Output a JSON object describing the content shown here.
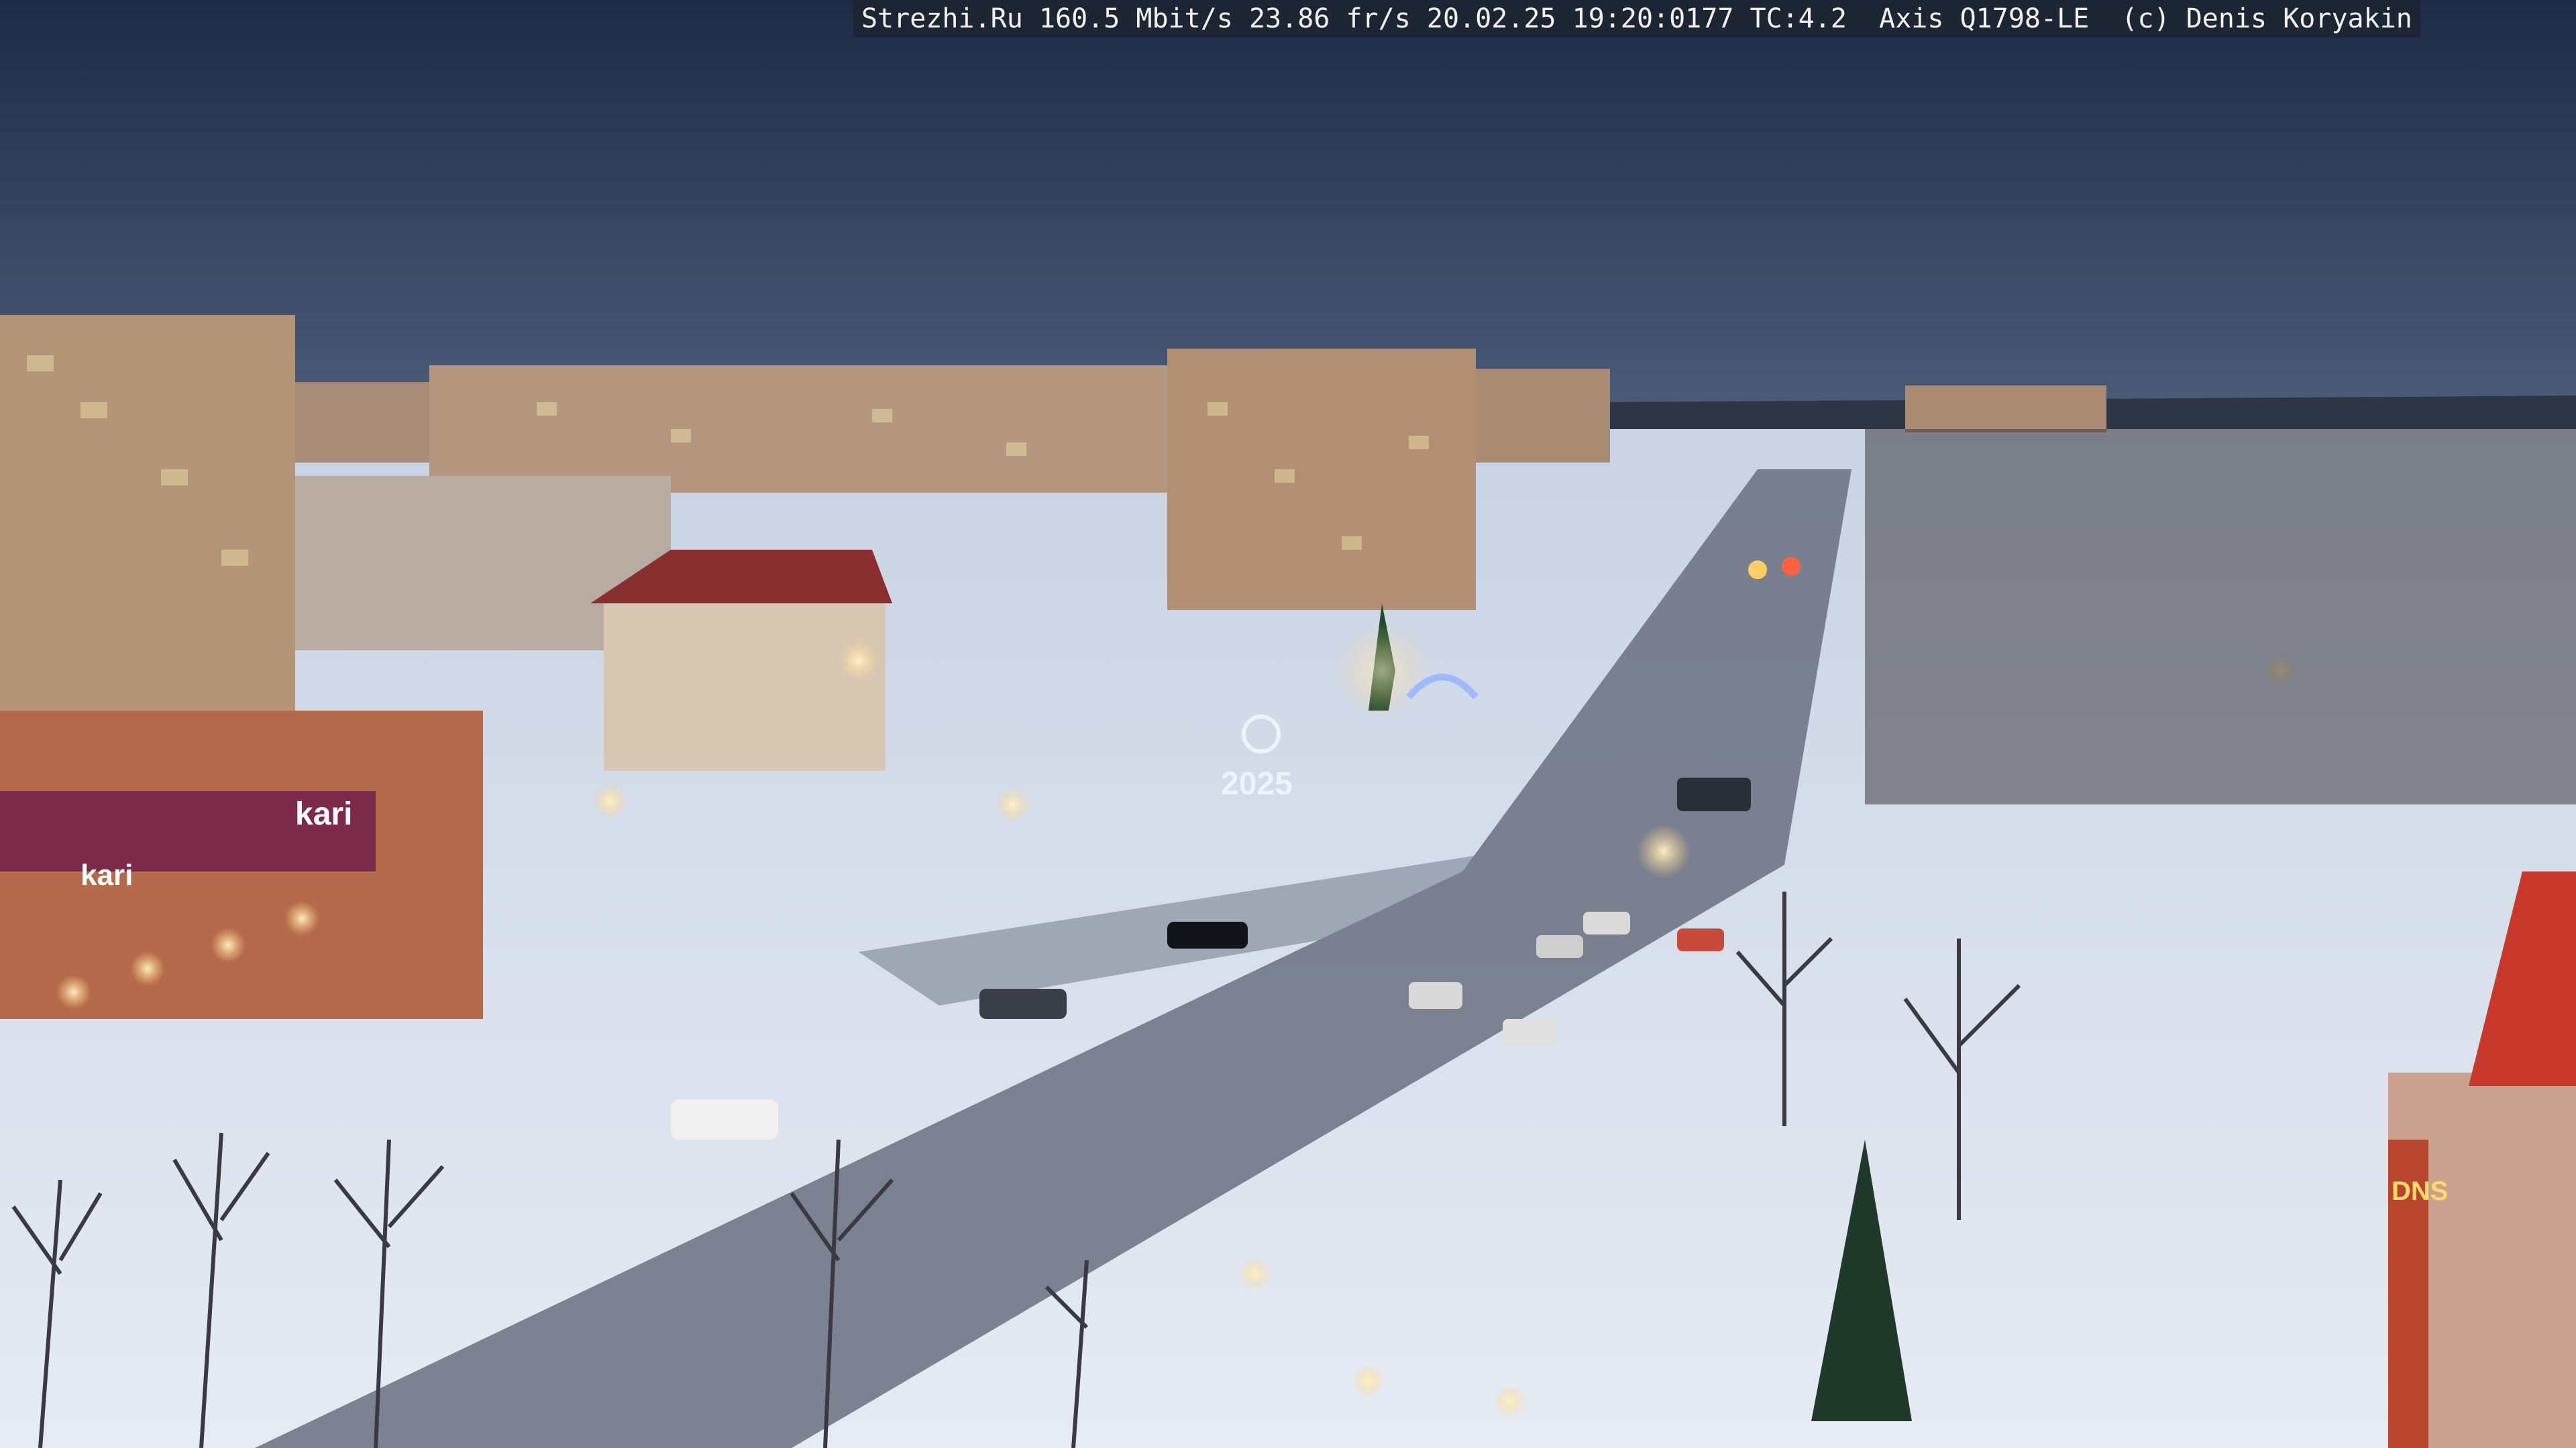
{
  "overlay": {
    "text": "Strezhi.Ru 160.5 Mbit/s 23.86 fr/s 20.02.25 19:20:0177 TC:4.2  Axis Q1798-LE  (c) Denis Koryakin"
  },
  "signs": {
    "store_brand": "kari",
    "store_brand_facade": "kari",
    "year_display": "2025",
    "right_building": "DNS"
  },
  "colors": {
    "sky_top": "#1e2b45",
    "sky_horizon": "#4a5a76",
    "snow": "#d9e0ec",
    "road": "#5a6070",
    "brick": "#b56a4c",
    "accent_red": "#c8392b"
  }
}
